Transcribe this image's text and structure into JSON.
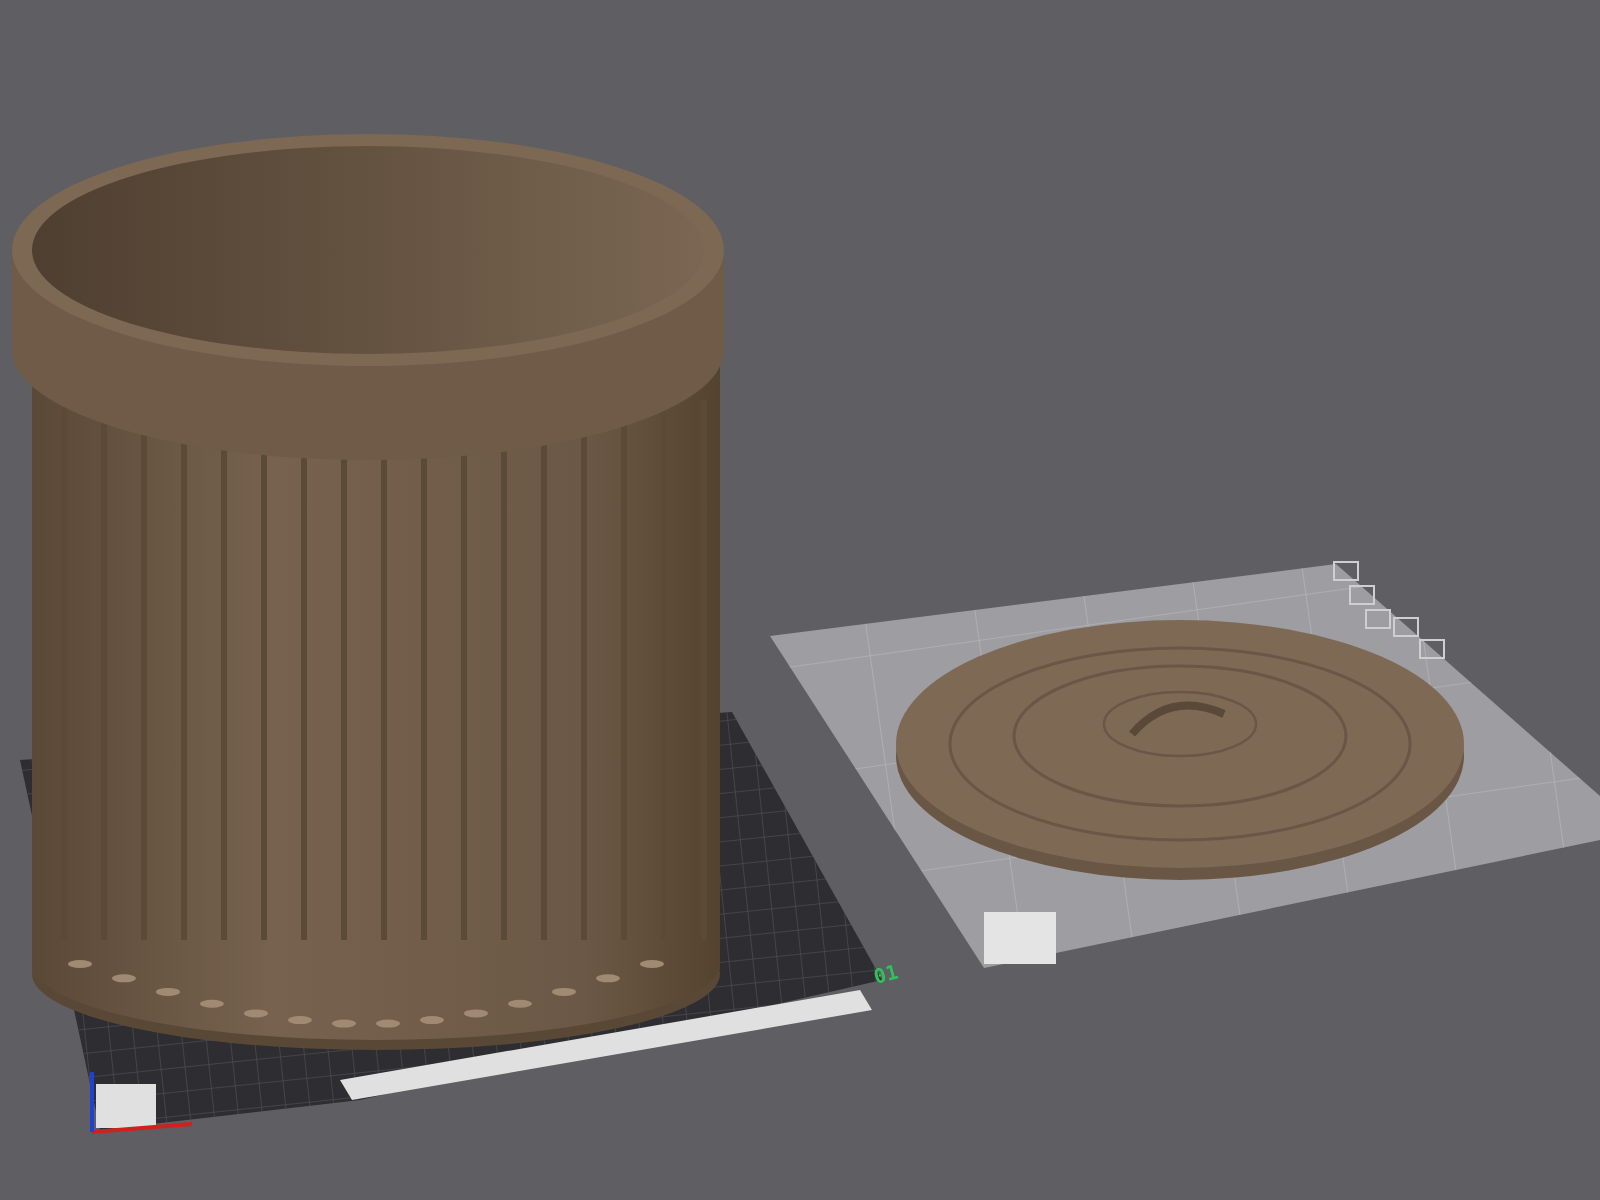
{
  "viewport": {
    "plate_label": "01"
  }
}
